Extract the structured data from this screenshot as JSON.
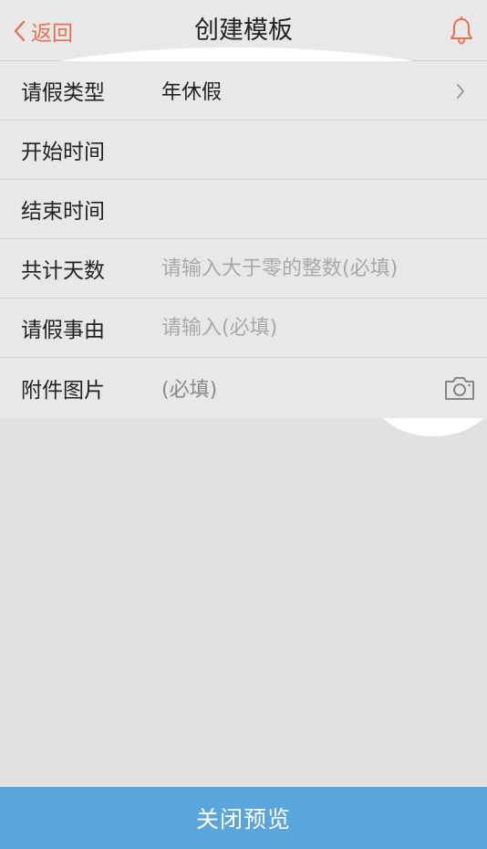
{
  "nav": {
    "back_label": "返回",
    "title": "创建模板",
    "bell_icon": "bell-icon",
    "accent_color": "#e8704f"
  },
  "form": {
    "leave_type": {
      "label": "请假类型",
      "value": "年休假"
    },
    "start_time": {
      "label": "开始时间",
      "value": ""
    },
    "end_time": {
      "label": "结束时间",
      "value": ""
    },
    "total_days": {
      "label": "共计天数",
      "value": "",
      "placeholder": "请输入大于零的整数(必填)"
    },
    "reason": {
      "label": "请假事由",
      "value": "",
      "placeholder": "请输入(必填)"
    },
    "attachment": {
      "label": "附件图片",
      "placeholder": "(必填)",
      "icon": "camera-icon"
    }
  },
  "footer": {
    "close_preview_label": "关闭预览",
    "color": "#5aa5dc"
  }
}
